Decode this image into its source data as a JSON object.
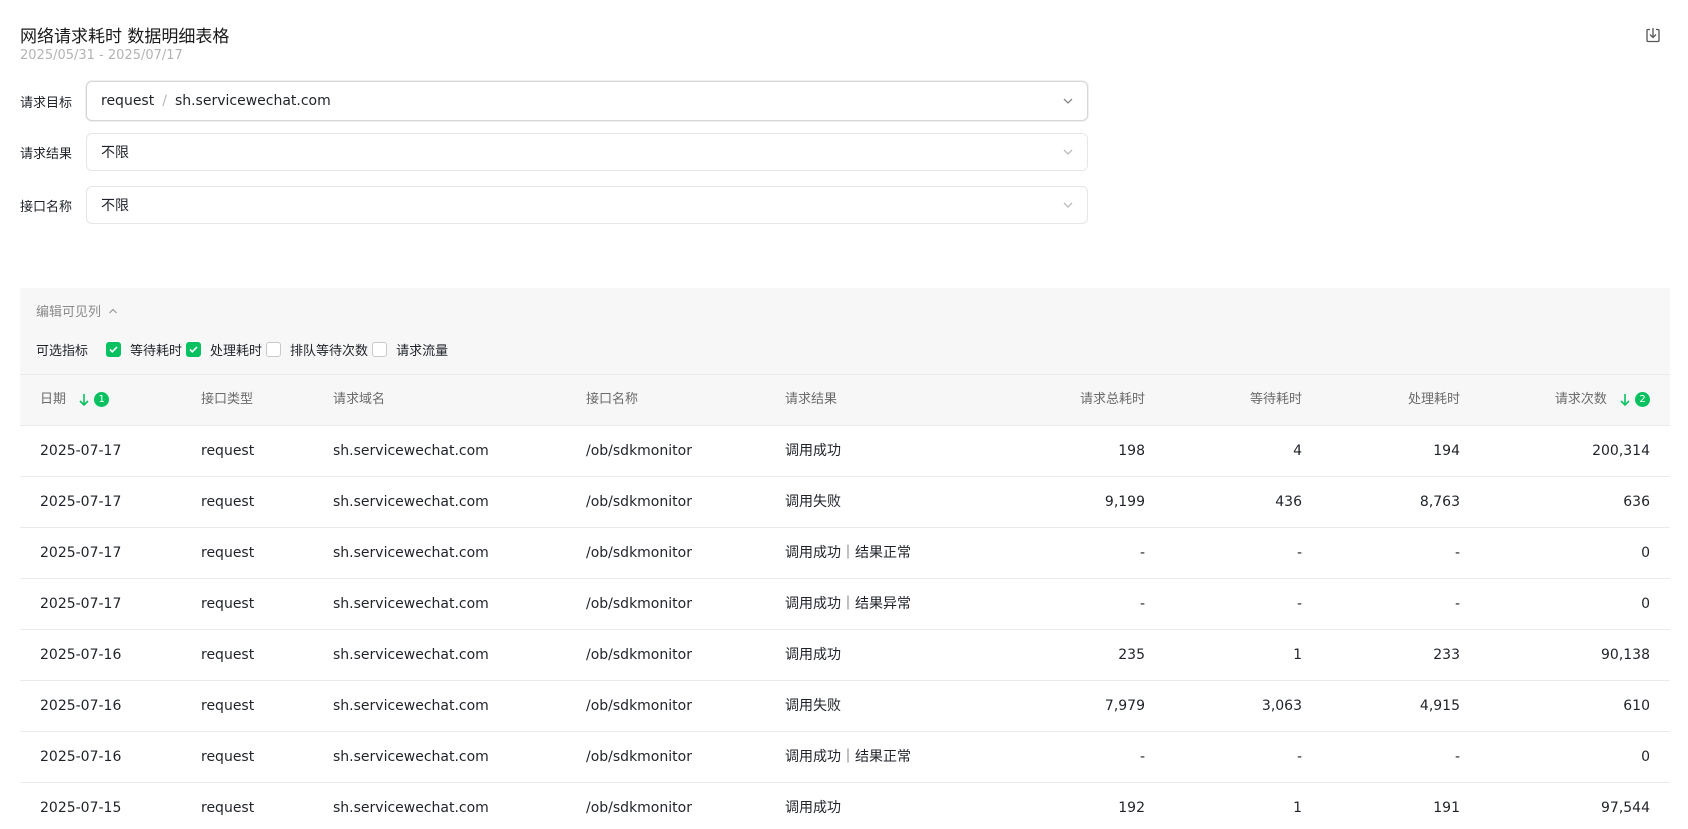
{
  "header": {
    "title": "网络请求耗时 数据明细表格",
    "date_range": "2025/05/31 - 2025/07/17",
    "export_icon": "download-icon"
  },
  "filters": {
    "target": {
      "label": "请求目标",
      "type_value": "request",
      "domain_value": "sh.servicewechat.com"
    },
    "result": {
      "label": "请求结果",
      "value": "不限"
    },
    "api": {
      "label": "接口名称",
      "value": "不限"
    }
  },
  "column_editor": {
    "toggle_label": "编辑可见列",
    "metrics_label": "可选指标",
    "options": [
      {
        "label": "等待耗时",
        "checked": true
      },
      {
        "label": "处理耗时",
        "checked": true
      },
      {
        "label": "排队等待次数",
        "checked": false
      },
      {
        "label": "请求流量",
        "checked": false
      }
    ]
  },
  "table": {
    "columns": [
      "日期",
      "接口类型",
      "请求域名",
      "接口名称",
      "请求结果",
      "请求总耗时",
      "等待耗时",
      "处理耗时",
      "请求次数"
    ],
    "sort_badges": {
      "date": "1",
      "count": "2"
    },
    "rows": [
      [
        "2025-07-17",
        "request",
        "sh.servicewechat.com",
        "/ob/sdkmonitor",
        "调用成功",
        "198",
        "4",
        "194",
        "200,314"
      ],
      [
        "2025-07-17",
        "request",
        "sh.servicewechat.com",
        "/ob/sdkmonitor",
        "调用失败",
        "9,199",
        "436",
        "8,763",
        "636"
      ],
      [
        "2025-07-17",
        "request",
        "sh.servicewechat.com",
        "/ob/sdkmonitor",
        "调用成功｜结果正常",
        "-",
        "-",
        "-",
        "0"
      ],
      [
        "2025-07-17",
        "request",
        "sh.servicewechat.com",
        "/ob/sdkmonitor",
        "调用成功｜结果异常",
        "-",
        "-",
        "-",
        "0"
      ],
      [
        "2025-07-16",
        "request",
        "sh.servicewechat.com",
        "/ob/sdkmonitor",
        "调用成功",
        "235",
        "1",
        "233",
        "90,138"
      ],
      [
        "2025-07-16",
        "request",
        "sh.servicewechat.com",
        "/ob/sdkmonitor",
        "调用失败",
        "7,979",
        "3,063",
        "4,915",
        "610"
      ],
      [
        "2025-07-16",
        "request",
        "sh.servicewechat.com",
        "/ob/sdkmonitor",
        "调用成功｜结果正常",
        "-",
        "-",
        "-",
        "0"
      ],
      [
        "2025-07-15",
        "request",
        "sh.servicewechat.com",
        "/ob/sdkmonitor",
        "调用成功",
        "192",
        "1",
        "191",
        "97,544"
      ]
    ]
  },
  "colors": {
    "accent": "#07c160",
    "header_bg": "#f7f7f7",
    "border": "#ebebeb"
  }
}
